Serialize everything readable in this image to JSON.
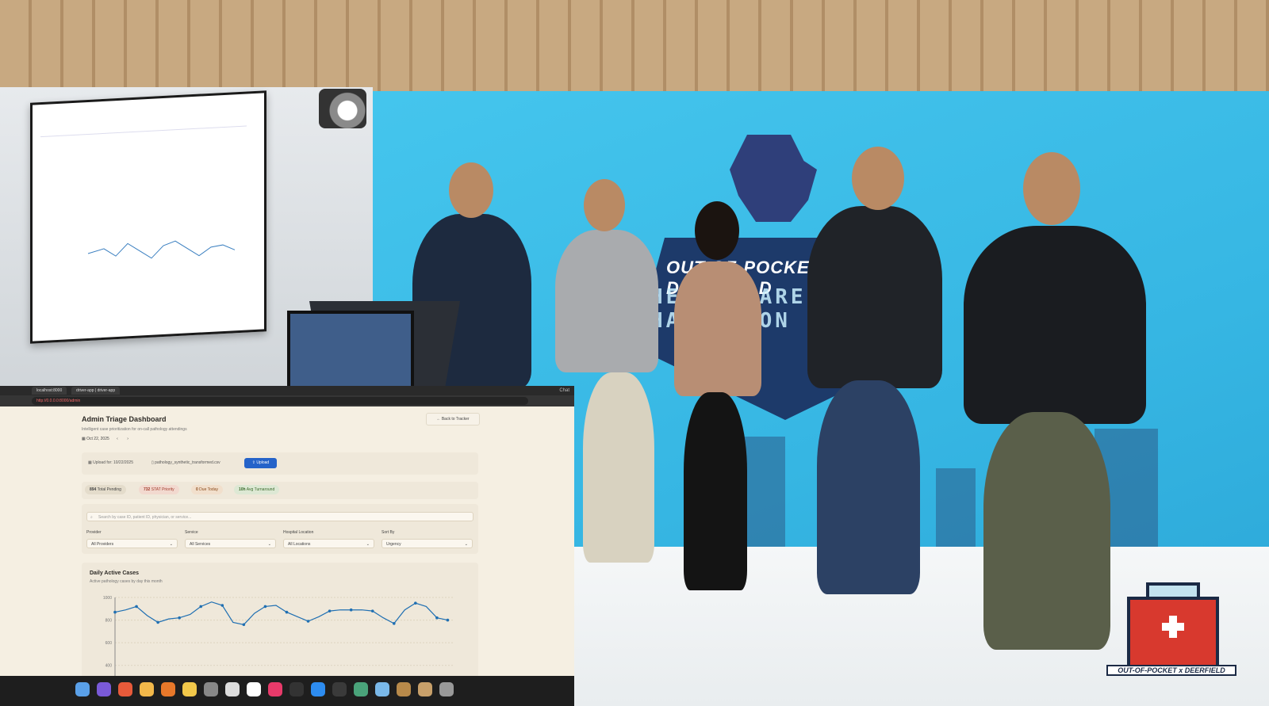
{
  "screen": {
    "browser": {
      "tab1": "localhost:8000",
      "tab2": "driver-app | driver-app",
      "url": "http://0.0.0.0:8000/admin",
      "right_label": "Chat"
    },
    "dashboard": {
      "title": "Admin Triage Dashboard",
      "subtitle": "Intelligent case prioritization for on-call pathology attendings",
      "date": "Oct 22, 2025",
      "back_button": "Back to Tracker",
      "upload_for": "Upload for: 10/22/2025",
      "file_name": "pathology_synthetic_transformed.csv",
      "upload_button": "Upload",
      "stats": [
        {
          "value": "894",
          "label": "Total Pending"
        },
        {
          "value": "732",
          "label": "STAT Priority"
        },
        {
          "value": "0",
          "label": "Due Today"
        },
        {
          "value": "10h",
          "label": "Avg Turnaround"
        }
      ],
      "search_placeholder": "Search by case ID, patient ID, physician, or service...",
      "filters": [
        {
          "label": "Provider",
          "value": "All Providers"
        },
        {
          "label": "Service",
          "value": "All Services"
        },
        {
          "label": "Hospital Location",
          "value": "All Locations"
        },
        {
          "label": "Sort By",
          "value": "Urgency"
        }
      ],
      "chart_title": "Daily Active Cases",
      "chart_subtitle": "Active pathology cases by day this month"
    }
  },
  "chart_data": {
    "type": "line",
    "title": "Daily Active Cases",
    "subtitle": "Active pathology cases by day this month",
    "y_ticks": [
      "1000",
      "800",
      "600",
      "400"
    ],
    "ylim": [
      300,
      1000
    ],
    "values": [
      870,
      890,
      920,
      840,
      780,
      810,
      820,
      850,
      920,
      960,
      930,
      780,
      760,
      860,
      920,
      930,
      870,
      830,
      790,
      830,
      880,
      890,
      890,
      890,
      880,
      820,
      770,
      890,
      950,
      920,
      820,
      800
    ],
    "color": "#1f6fb2",
    "grid": true
  },
  "stage": {
    "backdrop_text_1": "OUT-OF-POCKET x DEERFIELD",
    "backdrop_text_2": "HEALTHCARE HACKATHON",
    "corner_logo_text": "OUT-OF-POCKET x DEERFIELD",
    "colors": {
      "backdrop": "#3cbde8",
      "kit_red": "#d8392e",
      "navy": "#1b2a45"
    }
  }
}
